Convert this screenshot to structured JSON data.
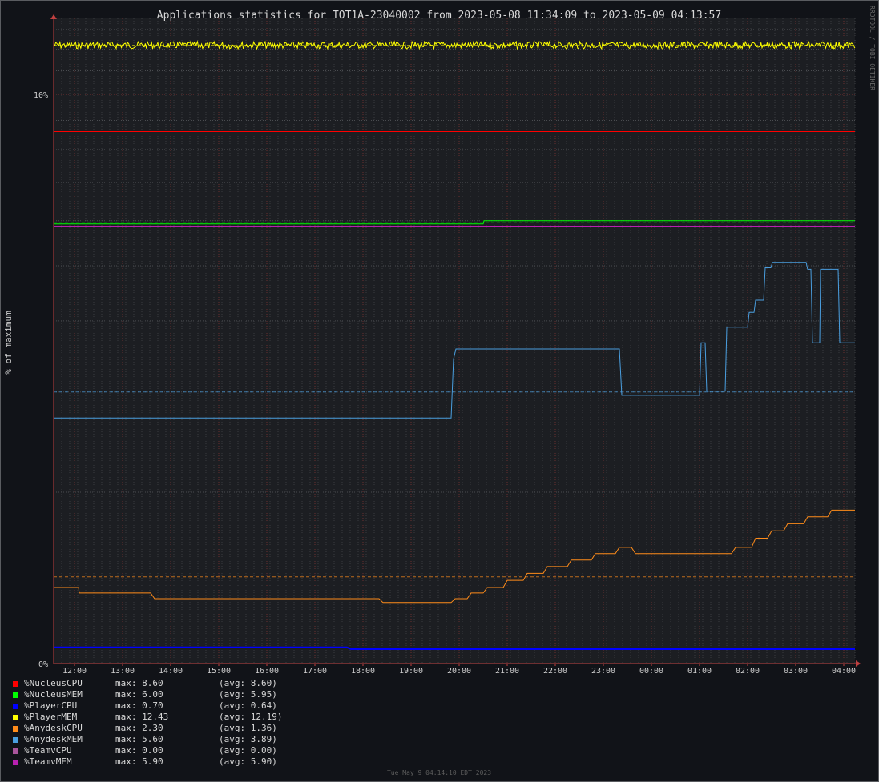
{
  "chart_data": {
    "type": "line",
    "title": "Applications statistics for TOT1A-23040002 from 2023-05-08 11:34:09 to 2023-05-09 04:13:57",
    "ylabel": "% of maximum",
    "watermark": "RRDTOOL / TOBI OETIKER",
    "footer": "Tue May  9 04:14:10 EDT 2023",
    "y_scale": "log",
    "ylim": [
      1,
      13.6
    ],
    "y_ticks": [
      {
        "value": 1,
        "label": "0%"
      },
      {
        "value": 10,
        "label": "10%"
      }
    ],
    "x_ticks": [
      "12:00",
      "13:00",
      "14:00",
      "15:00",
      "16:00",
      "17:00",
      "18:00",
      "19:00",
      "20:00",
      "21:00",
      "22:00",
      "23:00",
      "00:00",
      "01:00",
      "02:00",
      "03:00",
      "04:00"
    ],
    "x_range_hours": [
      "11:34",
      "04:14"
    ],
    "grid": true,
    "legend_position": "bottom-left",
    "series": [
      {
        "name": "%NucleusCPU",
        "color": "#ff0000",
        "max": "8.60",
        "avg": "8.60",
        "points": [
          [
            "11:34",
            8.6
          ],
          [
            "04:14",
            8.6
          ]
        ],
        "avg_line": false
      },
      {
        "name": "%NucleusMEM",
        "color": "#00ff00",
        "max": "6.00",
        "avg": "5.95",
        "points": [
          [
            "11:34",
            5.92
          ],
          [
            "20:30",
            5.92
          ],
          [
            "20:31",
            6.0
          ],
          [
            "04:14",
            6.0
          ]
        ],
        "avg_line": 5.95
      },
      {
        "name": "%PlayerCPU",
        "color": "#0000ff",
        "max": "0.70",
        "avg": "0.64",
        "points": [
          [
            "11:34",
            1.068
          ],
          [
            "17:40",
            1.068
          ],
          [
            "17:45",
            1.06
          ],
          [
            "04:14",
            1.06
          ]
        ],
        "avg_line": false
      },
      {
        "name": "%PlayerMEM",
        "color": "#ffff00",
        "max": "12.43",
        "avg": "12.19",
        "points": [
          [
            "11:34",
            12.2
          ],
          [
            "04:14",
            12.2
          ]
        ],
        "avg_line": 12.19,
        "noise": true
      },
      {
        "name": "%AnydeskCPU",
        "color": "#ff8c1a",
        "max": "2.30",
        "avg": "1.36",
        "points": [
          [
            "11:34",
            1.36
          ],
          [
            "12:05",
            1.36
          ],
          [
            "12:06",
            1.33
          ],
          [
            "13:35",
            1.33
          ],
          [
            "13:40",
            1.3
          ],
          [
            "18:20",
            1.3
          ],
          [
            "18:25",
            1.28
          ],
          [
            "19:50",
            1.28
          ],
          [
            "19:55",
            1.3
          ],
          [
            "20:10",
            1.3
          ],
          [
            "20:15",
            1.33
          ],
          [
            "20:30",
            1.33
          ],
          [
            "20:35",
            1.36
          ],
          [
            "20:55",
            1.36
          ],
          [
            "21:00",
            1.4
          ],
          [
            "21:20",
            1.4
          ],
          [
            "21:25",
            1.44
          ],
          [
            "21:45",
            1.44
          ],
          [
            "21:50",
            1.48
          ],
          [
            "22:15",
            1.48
          ],
          [
            "22:20",
            1.52
          ],
          [
            "22:45",
            1.52
          ],
          [
            "22:50",
            1.56
          ],
          [
            "23:15",
            1.56
          ],
          [
            "23:20",
            1.6
          ],
          [
            "23:35",
            1.6
          ],
          [
            "23:40",
            1.56
          ],
          [
            "01:40",
            1.56
          ],
          [
            "01:45",
            1.6
          ],
          [
            "02:05",
            1.6
          ],
          [
            "02:10",
            1.66
          ],
          [
            "02:25",
            1.66
          ],
          [
            "02:30",
            1.71
          ],
          [
            "02:45",
            1.71
          ],
          [
            "02:50",
            1.76
          ],
          [
            "03:10",
            1.76
          ],
          [
            "03:15",
            1.81
          ],
          [
            "03:40",
            1.81
          ],
          [
            "03:45",
            1.86
          ],
          [
            "04:14",
            1.86
          ]
        ],
        "avg_line": 1.42
      },
      {
        "name": "%AnydeskMEM",
        "color": "#4a9fe0",
        "max": "5.60",
        "avg": "3.89",
        "points": [
          [
            "11:34",
            2.7
          ],
          [
            "19:50",
            2.7
          ],
          [
            "19:53",
            3.43
          ],
          [
            "19:56",
            3.57
          ],
          [
            "23:20",
            3.57
          ],
          [
            "23:23",
            2.96
          ],
          [
            "01:00",
            2.96
          ],
          [
            "01:02",
            3.66
          ],
          [
            "01:07",
            3.66
          ],
          [
            "01:09",
            3.01
          ],
          [
            "01:32",
            3.01
          ],
          [
            "01:34",
            3.9
          ],
          [
            "02:00",
            3.9
          ],
          [
            "02:02",
            4.14
          ],
          [
            "02:08",
            4.14
          ],
          [
            "02:10",
            4.35
          ],
          [
            "02:20",
            4.35
          ],
          [
            "02:22",
            4.96
          ],
          [
            "02:29",
            4.96
          ],
          [
            "02:31",
            5.07
          ],
          [
            "03:13",
            5.07
          ],
          [
            "03:15",
            4.93
          ],
          [
            "03:19",
            4.93
          ],
          [
            "03:21",
            3.66
          ],
          [
            "03:30",
            3.66
          ],
          [
            "03:31",
            4.93
          ],
          [
            "03:53",
            4.93
          ],
          [
            "03:55",
            3.66
          ],
          [
            "04:14",
            3.66
          ]
        ],
        "avg_line": 3.0
      },
      {
        "name": "%TeamvCPU",
        "color": "#a9559c",
        "max": "0.00",
        "avg": "0.00",
        "points": [],
        "avg_line": false
      },
      {
        "name": "%TeamvMEM",
        "color": "#b820b0",
        "max": "5.90",
        "avg": "5.90",
        "points": [
          [
            "11:34",
            5.87
          ],
          [
            "04:14",
            5.87
          ]
        ],
        "avg_line": false
      }
    ]
  },
  "legend_labels": {
    "max_prefix": "max: ",
    "avg_prefix": "(avg: ",
    "avg_suffix": ")"
  }
}
